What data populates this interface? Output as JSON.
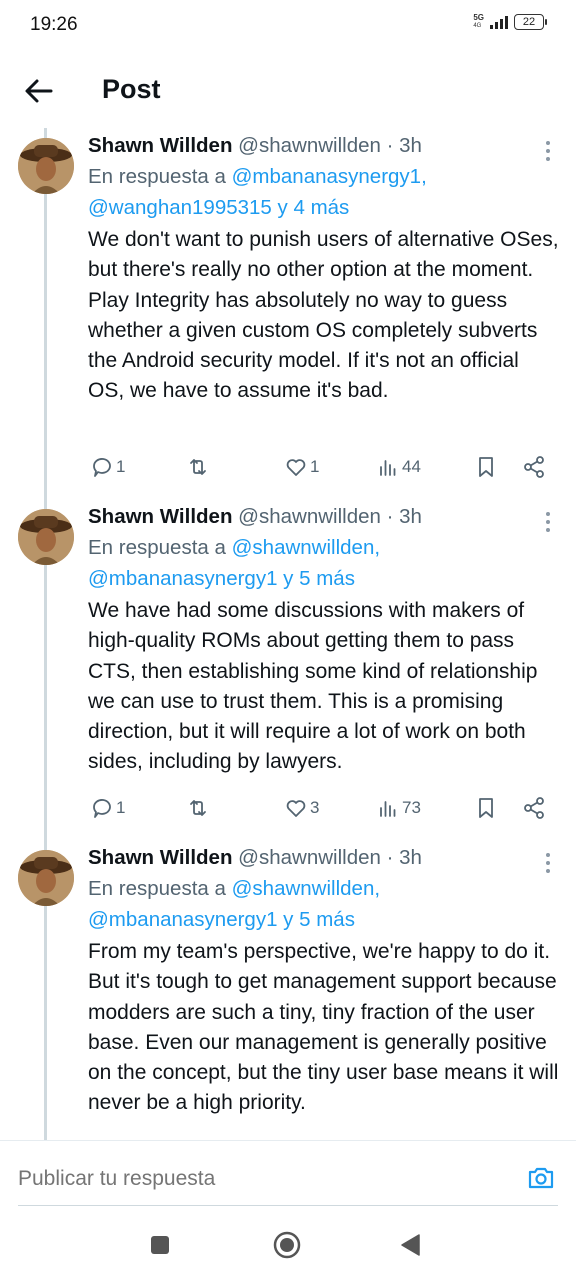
{
  "status_bar": {
    "time": "19:26",
    "network": "5G",
    "network_sub": "4G",
    "battery": "22"
  },
  "header": {
    "title": "Post",
    "back_icon": "arrow-left-icon"
  },
  "tweets": [
    {
      "author": "Shawn Willden",
      "handle": "@shawnwillden",
      "separator": "·",
      "time": "3h",
      "reply_prefix": "En respuesta a",
      "reply_mentions": "@mbananasynergy1, @wanghan1995315 y 4 más",
      "text": "We don't want to punish users of alternative OSes, but there's really no other option at the moment. Play Integrity has absolutely no way to guess whether a given custom OS completely subverts the Android security model. If it's not an official OS, we have to assume it's bad.",
      "replies": "1",
      "retweets": "",
      "likes": "1",
      "views": "44"
    },
    {
      "author": "Shawn Willden",
      "handle": "@shawnwillden",
      "separator": "·",
      "time": "3h",
      "reply_prefix": "En respuesta a",
      "reply_mentions": "@shawnwillden, @mbananasynergy1 y 5 más",
      "text": "We have had some discussions with makers of high-quality ROMs about getting them to pass CTS, then establishing some kind of relationship we can use to trust them.  This is a promising direction, but it will require a lot of work on both sides, including by lawyers.",
      "replies": "1",
      "retweets": "",
      "likes": "3",
      "views": "73"
    },
    {
      "author": "Shawn Willden",
      "handle": "@shawnwillden",
      "separator": "·",
      "time": "3h",
      "reply_prefix": "En respuesta a",
      "reply_mentions": "@shawnwillden, @mbananasynergy1 y 5 más",
      "text": "From my team's perspective, we're happy to do it. But it's tough to get management support because modders are such a tiny, tiny fraction of the user base. Even our management is generally positive on the concept, but the tiny user base means it will never be a high priority."
    }
  ],
  "reply_bar": {
    "placeholder": "Publicar tu respuesta",
    "camera_icon": "camera-icon"
  },
  "colors": {
    "accent": "#1d9bf0",
    "text": "#0f1419",
    "secondary": "#536471",
    "thread_line": "#cfd9de"
  },
  "nav": {
    "icons": [
      "recent-apps-icon",
      "home-icon",
      "back-triangle-icon"
    ]
  }
}
